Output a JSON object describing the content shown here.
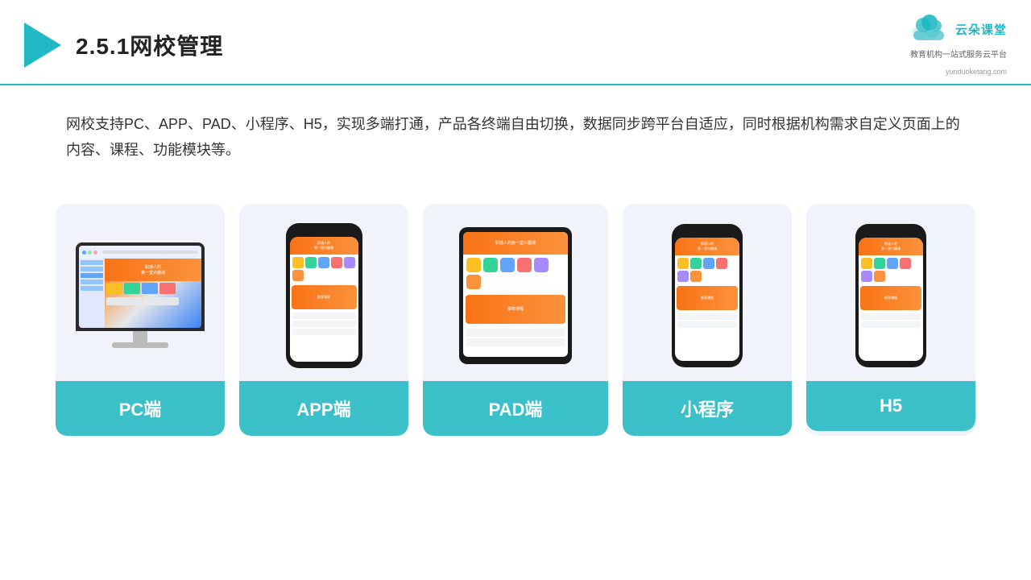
{
  "header": {
    "title": "2.5.1网校管理",
    "brand": {
      "name": "云朵课堂",
      "sub_line1": "教育机构一站",
      "sub_line2": "式服务云平台",
      "url": "yunduoketang.com"
    }
  },
  "description": {
    "text": "网校支持PC、APP、PAD、小程序、H5，实现多端打通，产品各终端自由切换，数据同步跨平台自适应，同时根据机构需求自定义页面上的内容、课程、功能模块等。"
  },
  "cards": [
    {
      "id": "pc",
      "label": "PC端",
      "device": "monitor"
    },
    {
      "id": "app",
      "label": "APP端",
      "device": "phone"
    },
    {
      "id": "pad",
      "label": "PAD端",
      "device": "tablet"
    },
    {
      "id": "miniprogram",
      "label": "小程序",
      "device": "phone"
    },
    {
      "id": "h5",
      "label": "H5",
      "device": "phone"
    }
  ],
  "colors": {
    "teal": "#3bbfc8",
    "accent": "#f97316",
    "header_line": "#1fb8c3"
  }
}
